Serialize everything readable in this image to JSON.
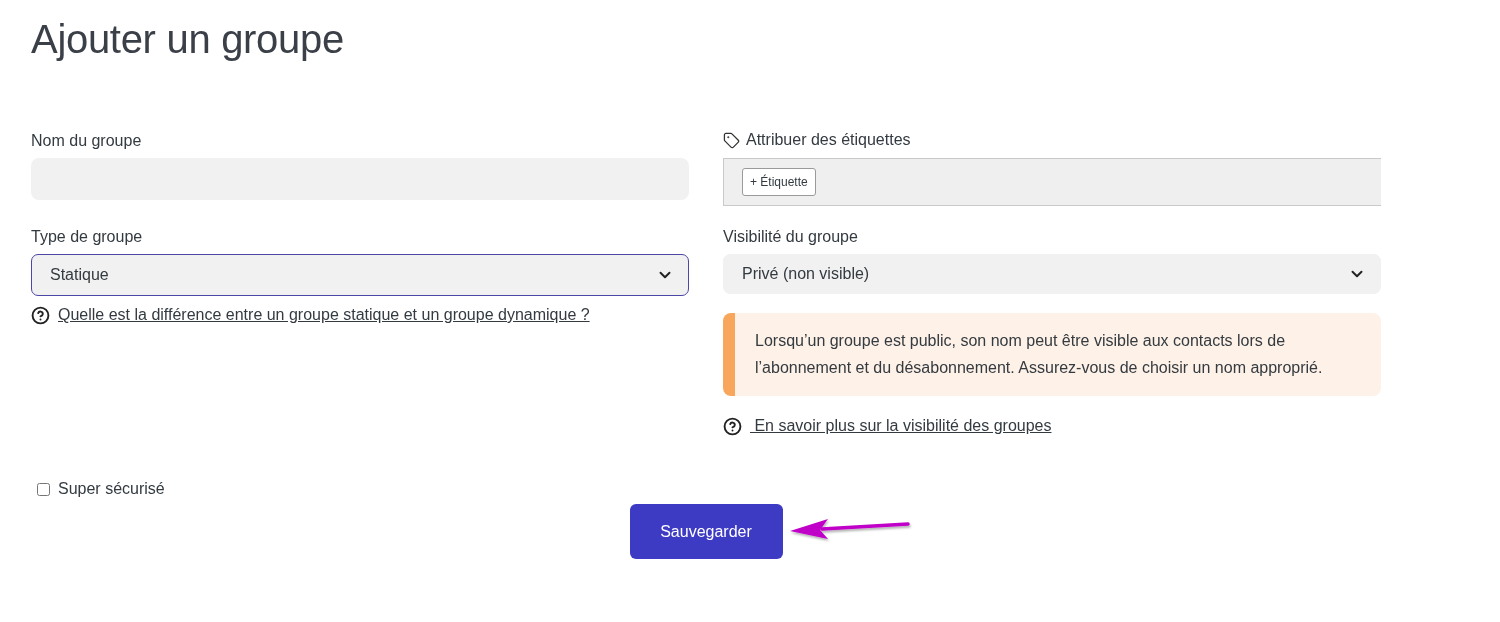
{
  "title": "Ajouter un groupe",
  "left": {
    "name_field": {
      "label": "Nom du groupe"
    },
    "type_field": {
      "label": "Type de groupe",
      "value": "Statique",
      "focused": true
    },
    "help_link": "Quelle est la différence entre un groupe statique et un groupe dynamique ?"
  },
  "right": {
    "tags": {
      "label": "Attribuer des étiquettes",
      "add_button": "+ Étiquette"
    },
    "visibility_field": {
      "label": "Visibilité du groupe",
      "value": "Privé (non visible)",
      "focused": false
    },
    "alert": {
      "kind": "warning",
      "text": "Lorsqu’un groupe est public, son nom peut être visible aux contacts lors de l’abonnement et du désabonnement. Assurez-vous de choisir un nom approprié."
    },
    "help_link": " En savoir plus sur la visibilité des groupes"
  },
  "checkbox": {
    "label": "Super sécurisé",
    "checked": false
  },
  "save_button": "Sauvegarder"
}
